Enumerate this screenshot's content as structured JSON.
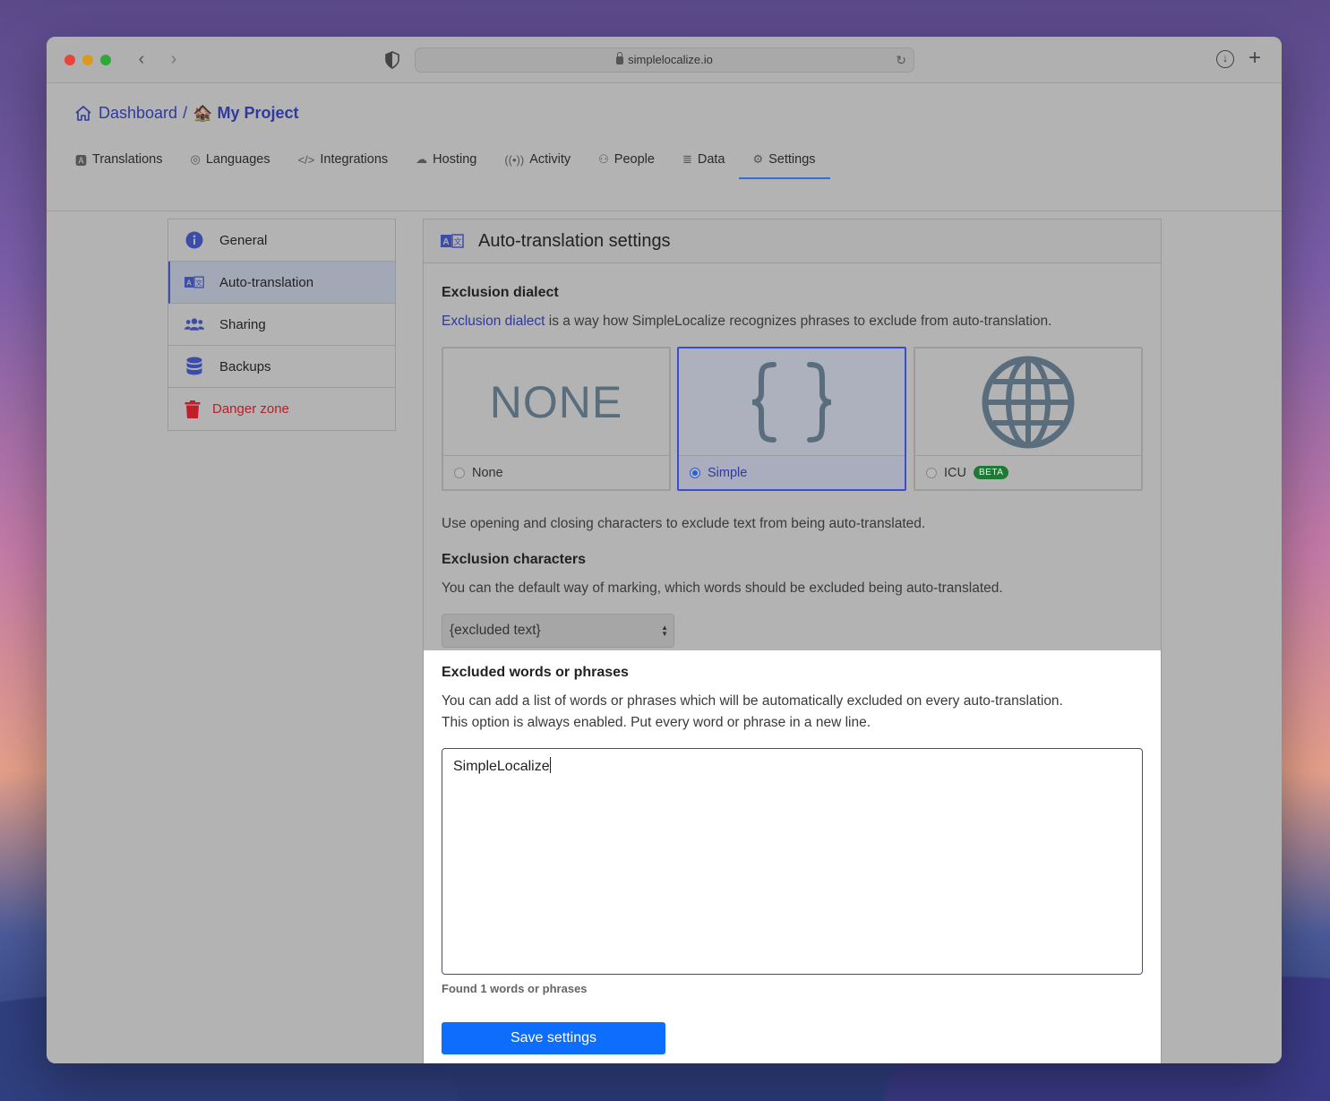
{
  "browser": {
    "url": "simplelocalize.io"
  },
  "breadcrumb": {
    "home": "Dashboard",
    "separator": "/",
    "project_emoji": "🏚️",
    "project": "My Project"
  },
  "tabs": [
    {
      "label": "Translations",
      "icon": "translate-icon"
    },
    {
      "label": "Languages",
      "icon": "globe-icon"
    },
    {
      "label": "Integrations",
      "icon": "code-icon"
    },
    {
      "label": "Hosting",
      "icon": "cloud-icon"
    },
    {
      "label": "Activity",
      "icon": "broadcast-icon"
    },
    {
      "label": "People",
      "icon": "people-icon"
    },
    {
      "label": "Data",
      "icon": "database-icon"
    },
    {
      "label": "Settings",
      "icon": "gear-icon",
      "active": true
    }
  ],
  "sidebar": {
    "items": [
      {
        "label": "General",
        "icon": "info-icon"
      },
      {
        "label": "Auto-translation",
        "icon": "translate-icon",
        "active": true
      },
      {
        "label": "Sharing",
        "icon": "people-icon"
      },
      {
        "label": "Backups",
        "icon": "database-icon"
      },
      {
        "label": "Danger zone",
        "icon": "trash-icon"
      }
    ]
  },
  "panel": {
    "title": "Auto-translation settings",
    "dialect": {
      "title": "Exclusion dialect",
      "link": "Exclusion dialect",
      "description": " is a way how SimpleLocalize recognizes phrases to exclude from auto-translation.",
      "options": [
        {
          "label": "None",
          "art": "NONE",
          "selected": false
        },
        {
          "label": "Simple",
          "art": "braces-icon",
          "selected": true
        },
        {
          "label": "ICU",
          "art": "globe-icon",
          "badge": "BETA",
          "selected": false
        }
      ],
      "hint": "Use opening and closing characters to exclude text from being auto-translated."
    },
    "characters": {
      "title": "Exclusion characters",
      "description": "You can the default way of marking, which words should be excluded being auto-translated.",
      "selected_value": "{excluded text}"
    },
    "excluded": {
      "title": "Excluded words or phrases",
      "description_line1": "You can add a list of words or phrases which will be automatically excluded on every auto-translation.",
      "description_line2": "This option is always enabled. Put every word or phrase in a new line.",
      "textarea_value": "SimpleLocalize",
      "found": "Found 1 words or phrases"
    },
    "save_label": "Save settings"
  },
  "colors": {
    "accent": "#0d6efd",
    "link": "#2f3a9c",
    "danger": "#b4202a",
    "beta": "#1c7a35"
  }
}
